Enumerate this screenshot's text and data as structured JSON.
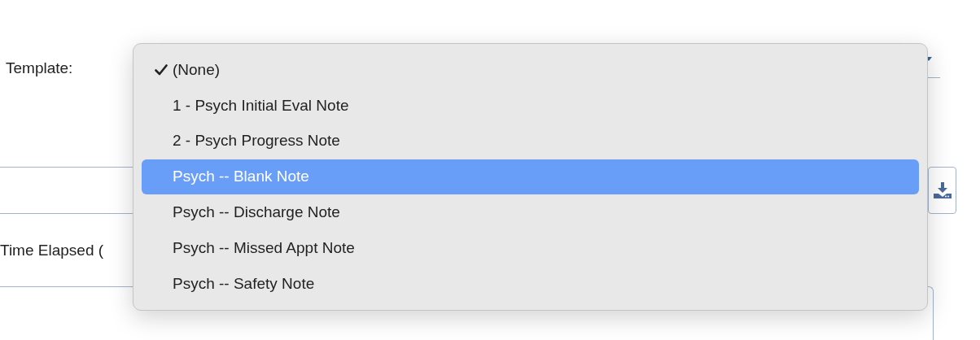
{
  "form": {
    "template_label": "Template:",
    "time_elapsed_label": "Time Elapsed ("
  },
  "template_menu": {
    "items": [
      {
        "label": "(None)",
        "checked": true,
        "highlighted": false
      },
      {
        "label": "1 - Psych Initial Eval Note",
        "checked": false,
        "highlighted": false
      },
      {
        "label": "2 - Psych Progress Note",
        "checked": false,
        "highlighted": false
      },
      {
        "label": "Psych -- Blank Note",
        "checked": false,
        "highlighted": true
      },
      {
        "label": "Psych -- Discharge Note",
        "checked": false,
        "highlighted": false
      },
      {
        "label": "Psych -- Missed Appt Note",
        "checked": false,
        "highlighted": false
      },
      {
        "label": "Psych -- Safety Note",
        "checked": false,
        "highlighted": false
      }
    ]
  }
}
